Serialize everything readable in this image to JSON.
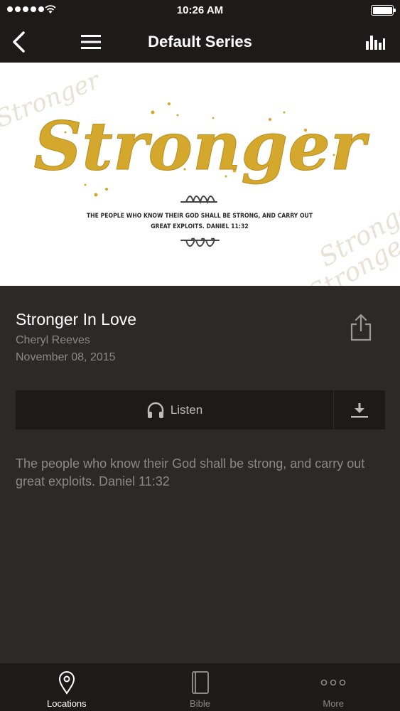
{
  "status_bar": {
    "time": "10:26 AM"
  },
  "nav": {
    "title": "Default Series"
  },
  "artwork": {
    "main_word": "Stronger",
    "verse_line1": "THE PEOPLE WHO KNOW THEIR GOD SHALL BE STRONG, AND CARRY OUT",
    "verse_line2": "GREAT EXPLOITS. DANIEL 11:32",
    "watermark": "Stronger",
    "gold_color": "#d4a82c"
  },
  "sermon": {
    "title": "Stronger In Love",
    "speaker": "Cheryl Reeves",
    "date": "November 08, 2015",
    "description": "The people who know their God shall be strong, and carry out great exploits. Daniel 11:32"
  },
  "actions": {
    "listen_label": "Listen"
  },
  "tabs": [
    {
      "label": "Locations",
      "icon": "location-pin-icon",
      "active": true
    },
    {
      "label": "Bible",
      "icon": "book-icon",
      "active": false
    },
    {
      "label": "More",
      "icon": "more-dots-icon",
      "active": false
    }
  ],
  "colors": {
    "bar_background": "#1c1b1a",
    "content_background": "#2b2a29",
    "secondary_text": "#8a8988",
    "inactive_tab": "#8a8988"
  }
}
